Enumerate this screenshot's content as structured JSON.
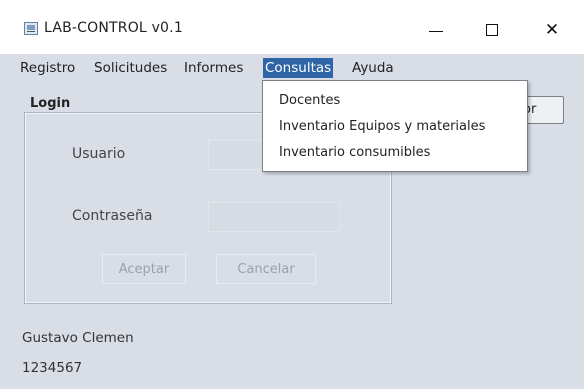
{
  "window": {
    "title": "LAB-CONTROL v0.1",
    "icon": "app-window-icon",
    "controls": {
      "minimize": "minimize-icon",
      "maximize": "maximize-icon",
      "close": "✕"
    }
  },
  "menubar": {
    "items": [
      {
        "label": "Registro"
      },
      {
        "label": "Solicitudes"
      },
      {
        "label": "Informes"
      },
      {
        "label": "Consultas",
        "active": true
      },
      {
        "label": "Ayuda"
      }
    ]
  },
  "dropdown": {
    "items": [
      {
        "label": "Docentes"
      },
      {
        "label": "Inventario Equipos y materiales"
      },
      {
        "label": "Inventario consumibles"
      }
    ]
  },
  "login": {
    "title": "Login",
    "user_label": "Usuario",
    "user_value": "",
    "password_label": "Contraseña",
    "password_value": "",
    "accept_label": "Aceptar",
    "cancel_label": "Cancelar"
  },
  "side_button": {
    "label": "or"
  },
  "status": {
    "user_name": "Gustavo Clemen",
    "user_id": "1234567"
  },
  "colors": {
    "menu_active_bg": "#2f65a6",
    "client_bg": "#d9dee6"
  }
}
